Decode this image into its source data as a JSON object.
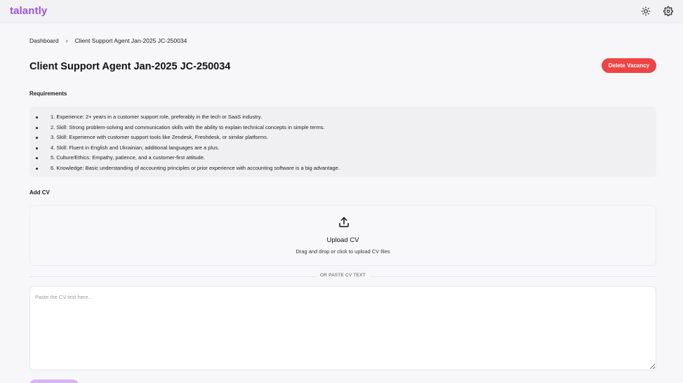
{
  "app": {
    "brand": "talantly",
    "accent_color": "#9b51e0"
  },
  "header": {
    "theme_icon": "sun-icon",
    "settings_icon": "gear-icon"
  },
  "breadcrumb": {
    "items": [
      "Dashboard",
      "Client Support Agent Jan-2025 JC-250034"
    ],
    "separator_icon": "chevron-right-icon"
  },
  "vacancy": {
    "title": "Client Support Agent Jan-2025 JC-250034",
    "delete_label": "Delete Vacancy",
    "delete_color": "#ef4444"
  },
  "requirements": {
    "label": "Requirements",
    "items": [
      "1. Experience: 2+ years in a customer support role, preferably in the tech or SaaS industry.",
      "2. Skill: Strong problem-solving and communication skills with the ability to explain technical concepts in simple terms.",
      "3. Skill: Experience with customer support tools like Zendesk, Freshdesk, or similar platforms.",
      "4. Skill: Fluent in English and Ukrainian; additional languages are a plus.",
      "5. Culture/Ethics: Empathy, patience, and a customer-first attitude.",
      "6. Knowledge: Basic understanding of accounting principles or prior experience with accounting software is a big advantage."
    ]
  },
  "add_cv": {
    "label": "Add CV",
    "upload_icon": "upload-icon",
    "upload_title": "Upload CV",
    "upload_subtitle": "Drag and drop or click to upload CV files",
    "divider_text": "OR PASTE CV TEXT",
    "textarea_placeholder": "Paste the CV text here...",
    "textarea_value": ""
  }
}
